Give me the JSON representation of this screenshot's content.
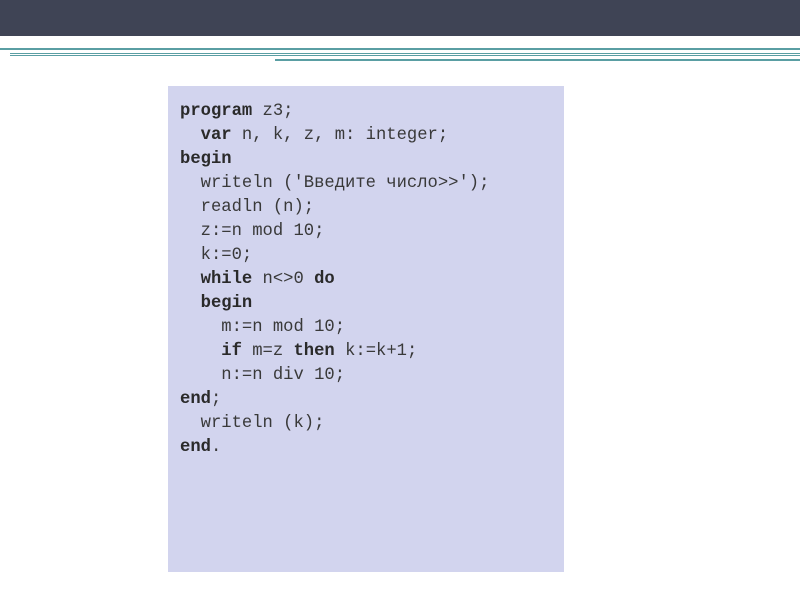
{
  "code": {
    "tokens": [
      {
        "t": "program ",
        "b": true
      },
      {
        "t": "z3;\n"
      },
      {
        "t": "  "
      },
      {
        "t": "var ",
        "b": true
      },
      {
        "t": "n, k, z, m: integer;\n"
      },
      {
        "t": "begin\n",
        "b": true
      },
      {
        "t": "  writeln ('Введите число>>');\n"
      },
      {
        "t": "  readln (n);\n"
      },
      {
        "t": "  z:=n mod 10;\n"
      },
      {
        "t": "  k:=0;\n"
      },
      {
        "t": "  "
      },
      {
        "t": "while ",
        "b": true
      },
      {
        "t": "n<>0 "
      },
      {
        "t": "do\n",
        "b": true
      },
      {
        "t": "  "
      },
      {
        "t": "begin\n",
        "b": true
      },
      {
        "t": "    m:=n mod 10;\n"
      },
      {
        "t": "    "
      },
      {
        "t": "if ",
        "b": true
      },
      {
        "t": "m=z "
      },
      {
        "t": "then ",
        "b": true
      },
      {
        "t": "k:=k+1;\n"
      },
      {
        "t": "    n:=n div 10;\n"
      },
      {
        "t": "end",
        "b": true
      },
      {
        "t": ";\n"
      },
      {
        "t": "  writeln (k);\n"
      },
      {
        "t": "end",
        "b": true
      },
      {
        "t": "."
      }
    ]
  }
}
